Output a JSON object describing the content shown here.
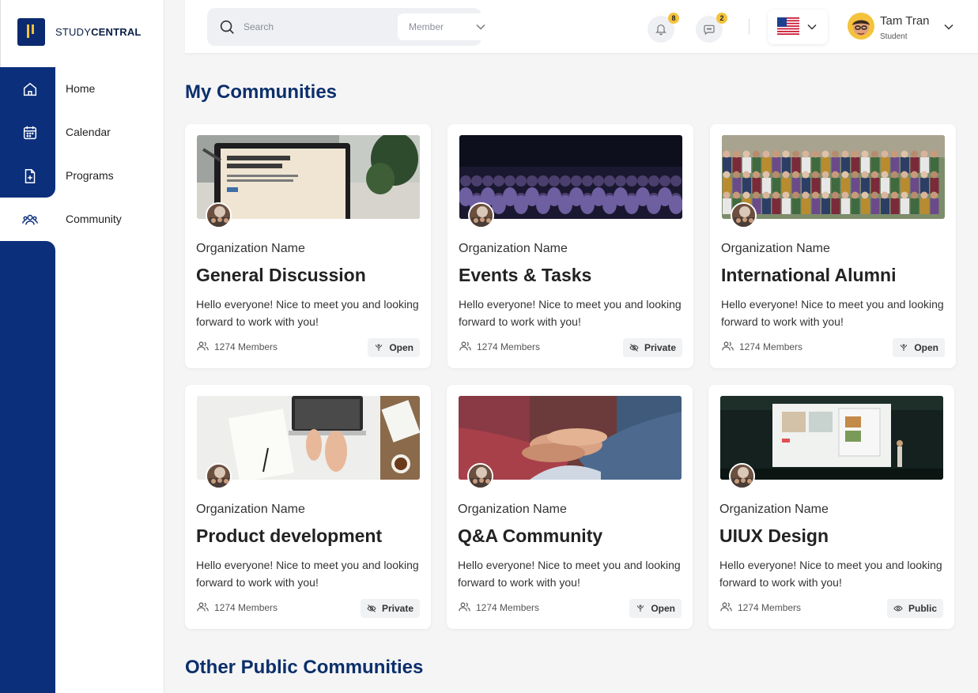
{
  "brand": {
    "name_prefix": "STUDY",
    "name_suffix": "CENTRAL",
    "accent": "#0b2f7b",
    "highlight": "#f4c23b"
  },
  "sidebar": {
    "items": [
      {
        "label": "Home",
        "icon": "home-icon"
      },
      {
        "label": "Calendar",
        "icon": "calendar-icon"
      },
      {
        "label": "Programs",
        "icon": "programs-icon"
      },
      {
        "label": "Community",
        "icon": "community-icon",
        "active": true
      }
    ]
  },
  "header": {
    "search_placeholder": "Search",
    "filter_value": "Member",
    "notifications_count": "8",
    "messages_count": "2",
    "language_icon": "us-flag-icon",
    "user": {
      "name": "Tam Tran",
      "role": "Student"
    }
  },
  "main": {
    "my_communities_title": "My Communities",
    "other_communities_title": "Other Public Communities",
    "cards": [
      {
        "org": "Organization Name",
        "title": "General Discussion",
        "desc": "Hello everyone! Nice to meet you and looking forward to work with you!",
        "members": "1274 Members",
        "privacy": "Open",
        "privacy_icon": "open-icon"
      },
      {
        "org": "Organization Name",
        "title": "Events & Tasks",
        "desc": "Hello everyone! Nice to meet you and looking forward to work with you!",
        "members": "1274 Members",
        "privacy": "Private",
        "privacy_icon": "eye-off-icon"
      },
      {
        "org": "Organization Name",
        "title": "International Alumni",
        "desc": "Hello everyone! Nice to meet you and looking forward to work with you!",
        "members": "1274 Members",
        "privacy": "Open",
        "privacy_icon": "open-icon"
      },
      {
        "org": "Organization Name",
        "title": "Product development",
        "desc": "Hello everyone! Nice to meet you and looking forward to work with you!",
        "members": "1274 Members",
        "privacy": "Private",
        "privacy_icon": "eye-off-icon"
      },
      {
        "org": "Organization Name",
        "title": "Q&A Community",
        "desc": "Hello everyone! Nice to meet you and looking forward to work with you!",
        "members": "1274 Members",
        "privacy": "Open",
        "privacy_icon": "open-icon"
      },
      {
        "org": "Organization Name",
        "title": "UIUX Design",
        "desc": "Hello everyone! Nice to meet you and looking forward to work with you!",
        "members": "1274 Members",
        "privacy": "Public",
        "privacy_icon": "eye-icon"
      }
    ]
  }
}
